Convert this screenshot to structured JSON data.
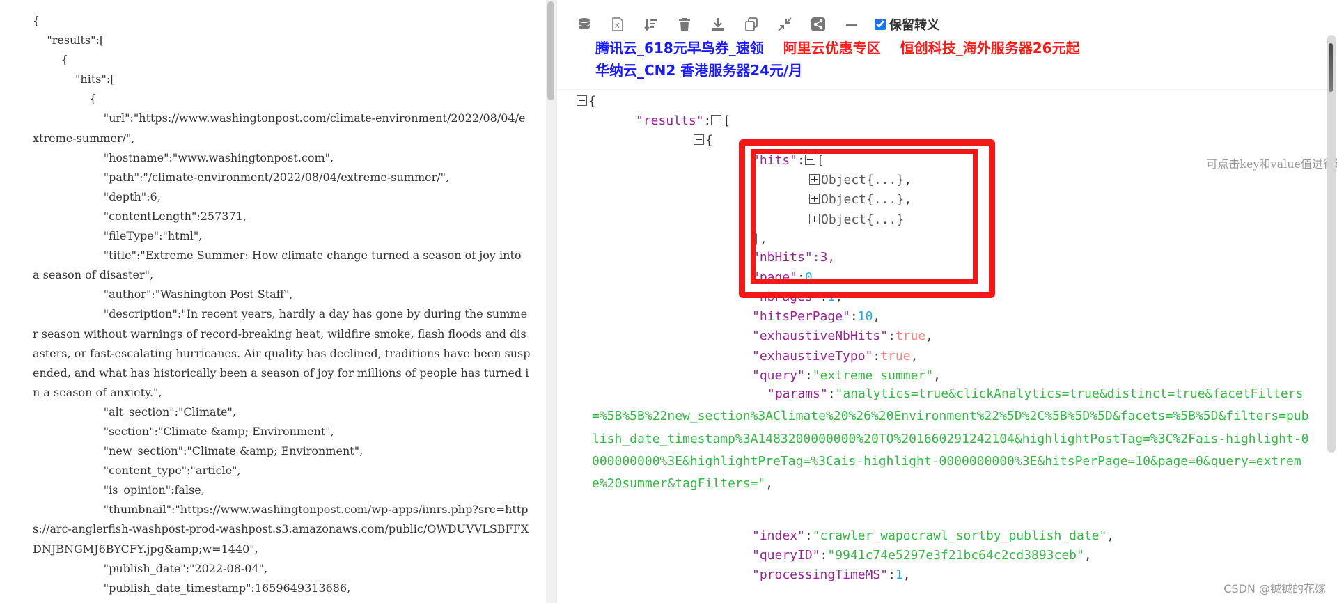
{
  "raw_json": {
    "text": "{\n    \"results\":[\n        {\n            \"hits\":[\n                {\n                    \"url\":\"https://www.washingtonpost.com/climate-environment/2022/08/04/extreme-summer/\",\n                    \"hostname\":\"www.washingtonpost.com\",\n                    \"path\":\"/climate-environment/2022/08/04/extreme-summer/\",\n                    \"depth\":6,\n                    \"contentLength\":257371,\n                    \"fileType\":\"html\",\n                    \"title\":\"Extreme Summer: How climate change turned a season of joy into a season of disaster\",\n                    \"author\":\"Washington Post Staff\",\n                    \"description\":\"In recent years, hardly a day has gone by during the summer season without warnings of record-breaking heat, wildfire smoke, flash floods and disasters, or fast-escalating hurricanes. Air quality has declined, traditions have been suspended, and what has historically been a season of joy for millions of people has turned in a season of anxiety.\",\n                    \"alt_section\":\"Climate\",\n                    \"section\":\"Climate &amp; Environment\",\n                    \"new_section\":\"Climate &amp; Environment\",\n                    \"content_type\":\"article\",\n                    \"is_opinion\":false,\n                    \"thumbnail\":\"https://www.washingtonpost.com/wp-apps/imrs.php?src=https://arc-anglerfish-washpost-prod-washpost.s3.amazonaws.com/public/OWDUVVLSBFFXDNJBNGMJ6BYCFY.jpg&amp;w=1440\",\n                    \"publish_date\":\"2022-08-04\",\n                    \"publish_date_timestamp\":1659649313686,"
  },
  "toolbar": {
    "icons": [
      "database-icon",
      "excel-icon",
      "sort-icon",
      "trash-icon",
      "download-icon",
      "copy-icon",
      "compress-icon",
      "share-icon",
      "minus-icon"
    ],
    "keep_escape_label": "保留转义",
    "keep_escape_checked": true
  },
  "ads": [
    {
      "text": "腾讯云_618元早鸟券_速领",
      "color": "#1a1aff"
    },
    {
      "text": "阿里云优惠专区",
      "color": "#ff1a1a"
    },
    {
      "text": "恒创科技_海外服务器26元起",
      "color": "#ff1a1a"
    },
    {
      "text": "华纳云_CN2 香港服务器24元/月",
      "color": "#1a1aff"
    }
  ],
  "hint": "可点击key和value值进行编辑",
  "tree": {
    "open_brace": "{",
    "results_key": "\"results\"",
    "hits_key": "\"hits\"",
    "object_label": "Object",
    "object_ellipsis": "{...}",
    "hits_close": "],",
    "nbhits_partial": "\"nbHits\":3,",
    "page_key": "\"page\"",
    "page_val": "0",
    "nbpages_key": "\"nbPages\"",
    "nbpages_val": "1",
    "hitsperpage_key": "\"hitsPerPage\"",
    "hitsperpage_val": "10",
    "exhaustivenbhits_key": "\"exhaustiveNbHits\"",
    "exhaustivenbhits_val": "true",
    "exhaustivetypo_key": "\"exhaustiveTypo\"",
    "exhaustivetypo_val": "true",
    "query_key": "\"query\"",
    "query_val": "\"extreme  summer\"",
    "params_key": "\"params\"",
    "params_val": "\"analytics=true&clickAnalytics=true&distinct=true&facetFilters=%5B%5B%22new_section%3AClimate%20%26%20Environment%22%5D%2C%5B%5D%5D&facets=%5B%5D&filters=publish_date_timestamp%3A1483200000000%20TO%201660291242104&highlightPostTag=%3C%2Fais-highlight-0000000000%3E&highlightPreTag=%3Cais-highlight-0000000000%3E&hitsPerPage=10&page=0&query=extreme%20summer&tagFilters=\"",
    "index_key": "\"index\"",
    "index_val": "\"crawler_wapocrawl_sortby_publish_date\"",
    "queryid_key": "\"queryID\"",
    "queryid_val": "\"9941c74e5297e3f21bc64c2cd3893ceb\"",
    "processing_key": "\"processingTimeMS\"",
    "processing_val": "1"
  },
  "watermark": "CSDN @铖铖的花嫁",
  "colors": {
    "key": "#92278f",
    "string": "#3ab54a",
    "number": "#25aae2",
    "boolean": "#f98280",
    "highlight": "#f31818"
  }
}
